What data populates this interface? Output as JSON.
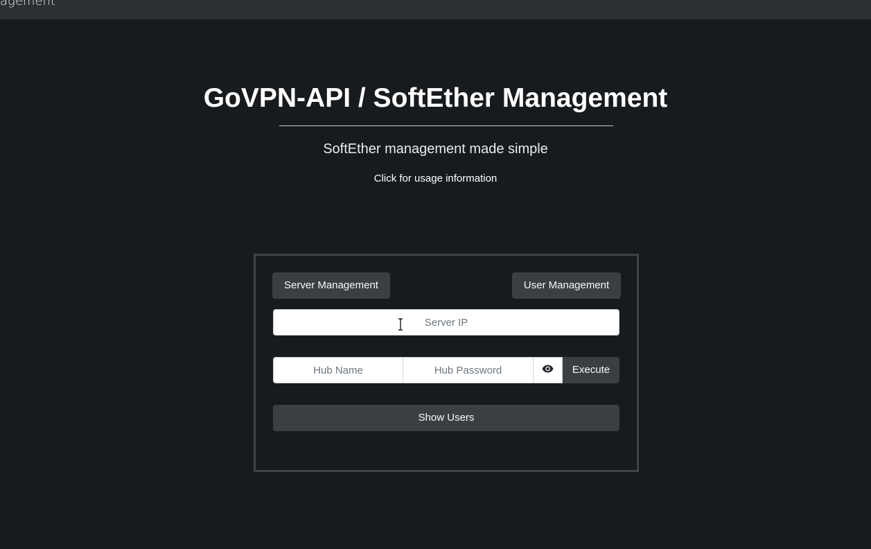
{
  "topbar": {
    "brand_fragment": "agement"
  },
  "hero": {
    "title": "GoVPN-API / SoftEther Management",
    "subtitle": "SoftEther management made simple",
    "usage_link": "Click for usage information"
  },
  "panel": {
    "server_management_label": "Server Management",
    "user_management_label": "User Management",
    "server_ip_placeholder": "Server IP",
    "hub_name_placeholder": "Hub Name",
    "hub_password_placeholder": "Hub Password",
    "toggle_password_icon": "eye-icon",
    "execute_label": "Execute",
    "show_users_label": "Show Users"
  },
  "colors": {
    "background": "#181b1e",
    "topbar": "#2b3035",
    "button": "#3a3f44",
    "panel_border": "#3f4448"
  }
}
